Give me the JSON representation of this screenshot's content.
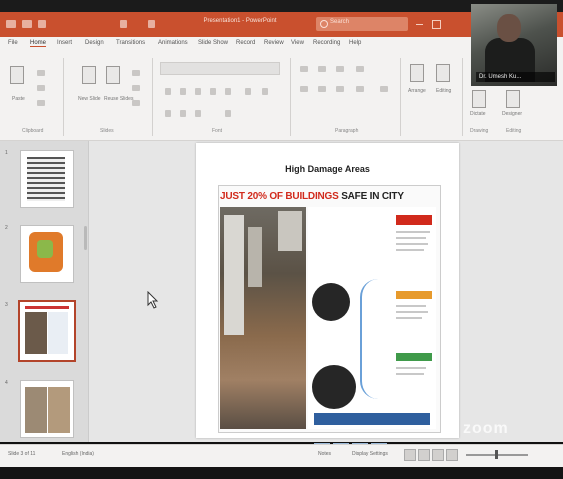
{
  "app": {
    "document_title": "Presentation1 - PowerPoint",
    "search_placeholder": "Search"
  },
  "menu": {
    "tabs": [
      "File",
      "Home",
      "Insert",
      "Design",
      "Transitions",
      "Animations",
      "Slide Show",
      "Record",
      "Review",
      "View",
      "Recording",
      "Help"
    ]
  },
  "ribbon": {
    "groups": [
      "Clipboard",
      "Slides",
      "Font",
      "Paragraph",
      "Drawing",
      "Editing"
    ],
    "buttons": {
      "paste": "Paste",
      "new_slide": "New Slide",
      "reuse_slides": "Reuse Slides",
      "arrange": "Arrange",
      "editing": "Editing",
      "dictate": "Dictate",
      "designer": "Designer"
    }
  },
  "video": {
    "participant_name": "Dr. Umesh Ku..."
  },
  "thumbnails": {
    "numbers": [
      "1",
      "2",
      "3",
      "4"
    ],
    "active_index": 3
  },
  "slide": {
    "title": "High Damage Areas",
    "headline_part1": "JUST 20% OF BUILDINGS ",
    "headline_part2": "SAFE IN CITY"
  },
  "status": {
    "slide_counter": "Slide 3 of 11",
    "language": "English (India)",
    "notes": "Notes",
    "display_settings": "Display Settings"
  },
  "watermark": "zoom",
  "colors": {
    "brand_accent": "#c9502e",
    "headline_red": "#d12a1c"
  }
}
